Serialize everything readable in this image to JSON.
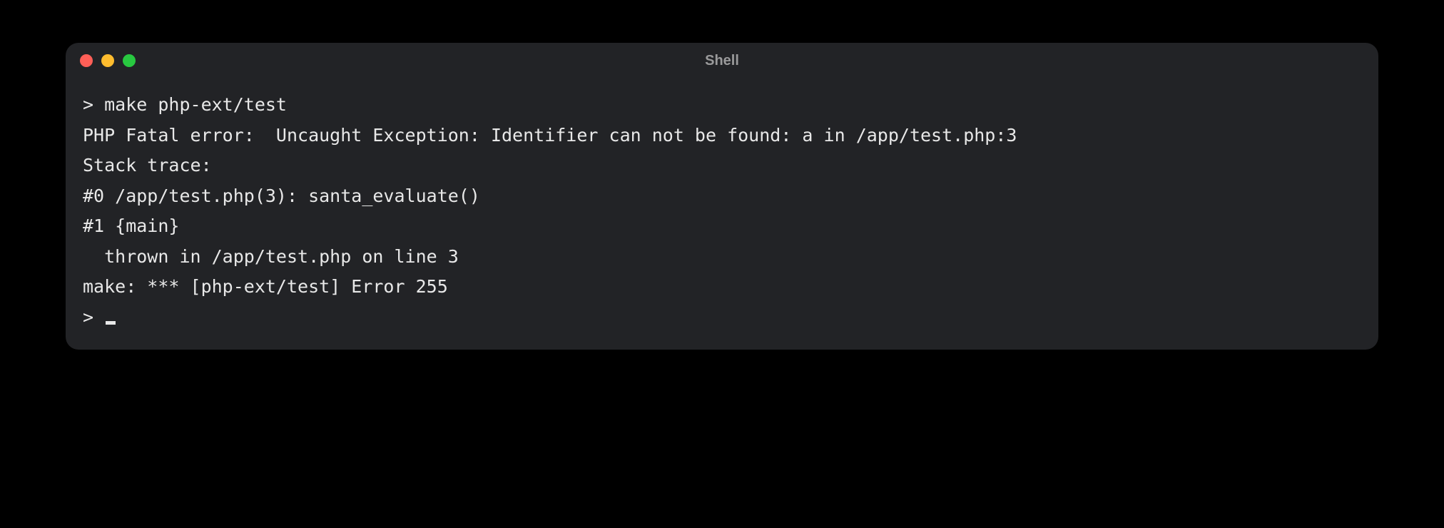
{
  "window": {
    "title": "Shell"
  },
  "terminal": {
    "prompt": "> ",
    "command": "make php-ext/test",
    "output_lines": [
      "PHP Fatal error:  Uncaught Exception: Identifier can not be found: a in /app/test.php:3",
      "Stack trace:",
      "#0 /app/test.php(3): santa_evaluate()",
      "#1 {main}",
      "  thrown in /app/test.php on line 3",
      "make: *** [php-ext/test] Error 255"
    ],
    "next_prompt": "> "
  }
}
